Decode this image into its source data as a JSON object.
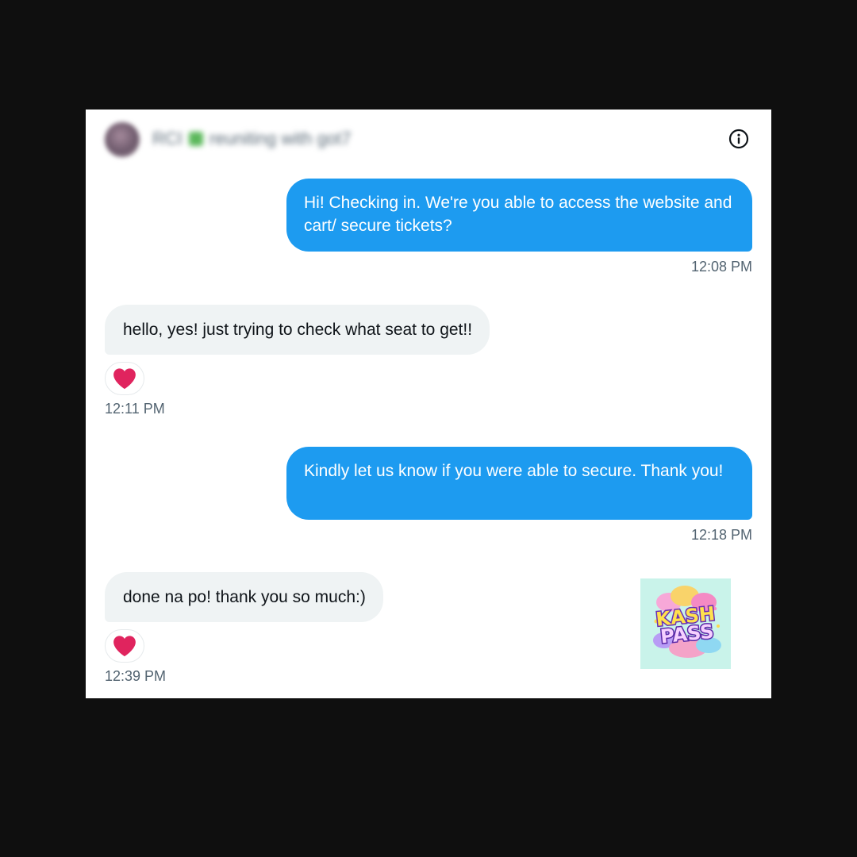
{
  "conversation": {
    "header": {
      "name": "RCI",
      "status_text": "reuniting with got7"
    },
    "messages": [
      {
        "direction": "outgoing",
        "text": "Hi! Checking in. We're you able to access the website and cart/ secure tickets?",
        "time": "12:08 PM"
      },
      {
        "direction": "incoming",
        "text": "hello, yes! just trying to check what seat to get!!",
        "time": "12:11 PM",
        "reaction": "heart"
      },
      {
        "direction": "outgoing",
        "text": "Kindly let us know if you were able to secure. Thank you!",
        "time": "12:18 PM"
      },
      {
        "direction": "incoming",
        "text": "done na po! thank you so much:)",
        "time": "12:39 PM",
        "reaction": "heart"
      }
    ]
  },
  "watermark": {
    "line1": "KASH",
    "line2": "PASS"
  },
  "icons": {
    "info": "info-icon",
    "heart": "heart-icon"
  },
  "colors": {
    "outgoing_bubble": "#1d9bf0",
    "incoming_bubble": "#eff3f4",
    "heart": "#e0245e",
    "timestamp": "#536471",
    "backdrop": "#0f0f0f"
  }
}
